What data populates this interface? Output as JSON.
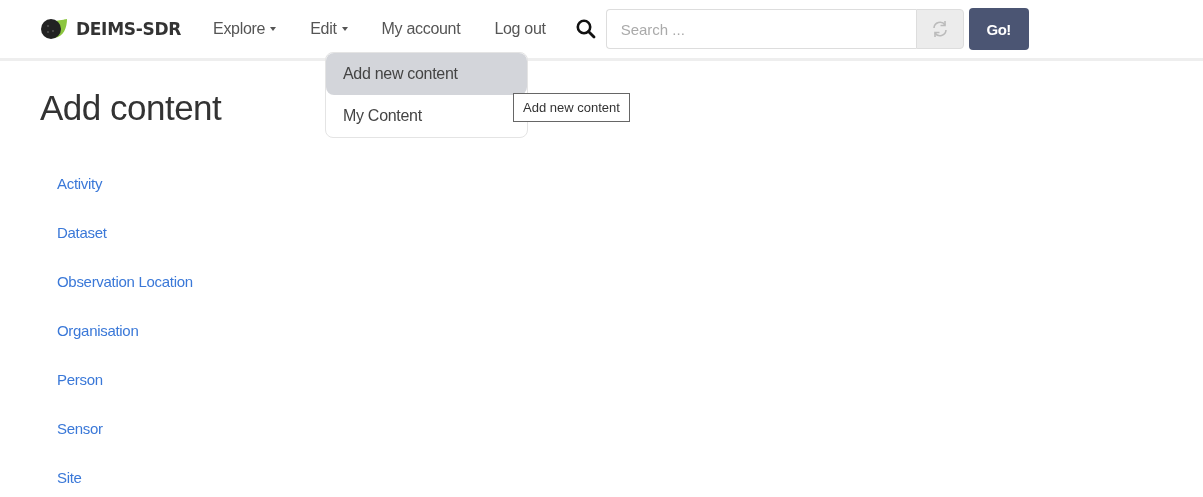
{
  "brand": {
    "name": "DEIMS-SDR"
  },
  "nav": [
    {
      "label": "Explore",
      "dropdown": true
    },
    {
      "label": "Edit",
      "dropdown": true
    },
    {
      "label": "My account",
      "dropdown": false
    },
    {
      "label": "Log out",
      "dropdown": false
    }
  ],
  "search": {
    "placeholder": "Search ...",
    "button": "Go!"
  },
  "menu": {
    "items": [
      {
        "label": "Add new content",
        "selected": true
      },
      {
        "label": "My Content",
        "selected": false
      }
    ]
  },
  "tooltip": "Add new content",
  "page": {
    "title": "Add content",
    "links": [
      "Activity",
      "Dataset",
      "Observation Location",
      "Organisation",
      "Person",
      "Sensor",
      "Site"
    ]
  }
}
